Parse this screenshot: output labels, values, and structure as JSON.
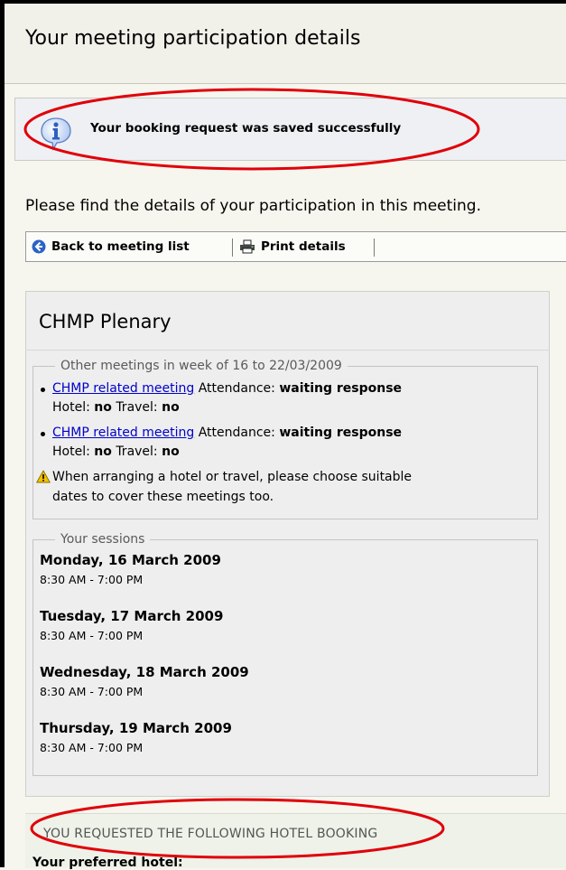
{
  "page": {
    "title": "Your meeting participation details"
  },
  "notice": {
    "icon": "info-icon",
    "message": "Your booking request was saved successfully"
  },
  "intro": "Please find the details of your participation in this meeting.",
  "toolbar": {
    "back_label": "Back to meeting list",
    "back_icon": "arrow-left-circle-icon",
    "print_label": "Print details",
    "print_icon": "printer-icon"
  },
  "meeting": {
    "title": "CHMP Plenary",
    "other_meetings": {
      "legend": "Other meetings in week of 16 to 22/03/2009",
      "items": [
        {
          "link": "CHMP related meeting",
          "attendance_label": "Attendance:",
          "attendance_value": "waiting response",
          "hotel_label": "Hotel:",
          "hotel_value": "no",
          "travel_label": "Travel:",
          "travel_value": "no"
        },
        {
          "link": "CHMP related meeting",
          "attendance_label": "Attendance:",
          "attendance_value": "waiting response",
          "hotel_label": "Hotel:",
          "hotel_value": "no",
          "travel_label": "Travel:",
          "travel_value": "no"
        }
      ],
      "warning_icon": "warning-icon",
      "warning_line1": "When arranging a hotel or travel, please choose suitable",
      "warning_line2": "dates to cover these meetings too."
    },
    "sessions": {
      "legend": "Your sessions",
      "days": [
        {
          "date": "Monday, 16 March 2009",
          "time": "8:30 AM - 7:00 PM"
        },
        {
          "date": "Tuesday, 17 March 2009",
          "time": "8:30 AM - 7:00 PM"
        },
        {
          "date": "Wednesday, 18 March 2009",
          "time": "8:30 AM - 7:00 PM"
        },
        {
          "date": "Thursday, 19 March 2009",
          "time": "8:30 AM - 7:00 PM"
        }
      ]
    }
  },
  "hotel": {
    "heading": "YOU REQUESTED THE FOLLOWING HOTEL BOOKING",
    "preferred_label": "Your preferred hotel:"
  },
  "colors": {
    "link": "#0000cc",
    "annotation": "#e0000a",
    "warning": "#f2c200",
    "info": "#3b6fd0"
  }
}
